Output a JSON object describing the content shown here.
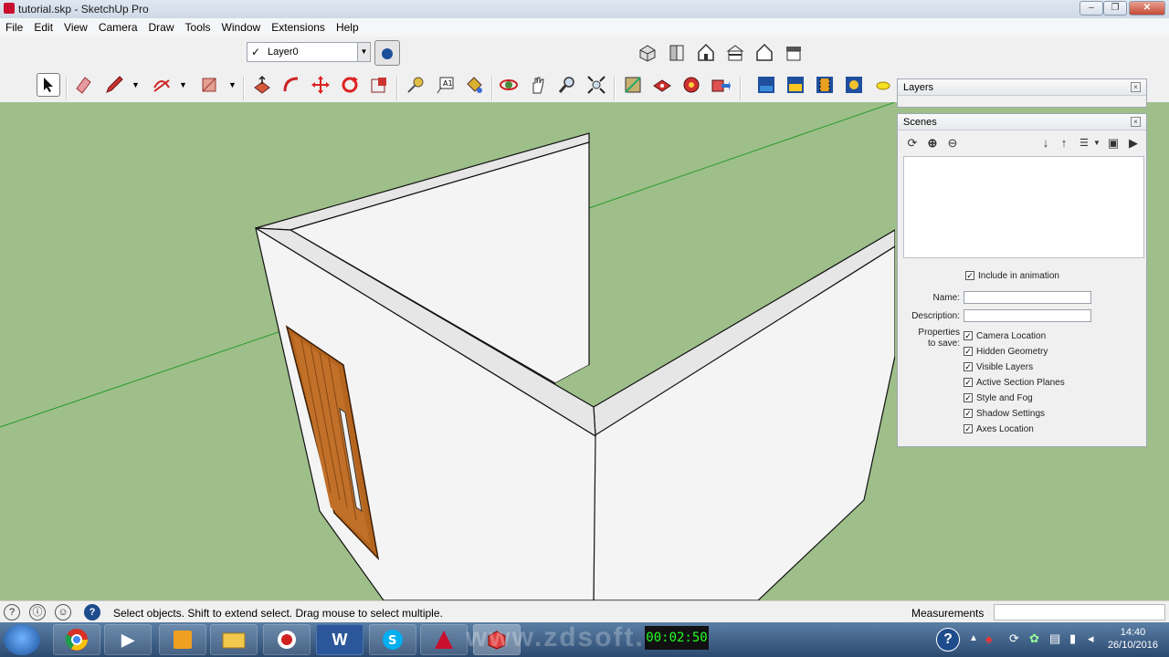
{
  "window": {
    "title": "tutorial.skp - SketchUp Pro",
    "controls": [
      "–",
      "❐",
      "✕"
    ]
  },
  "menu": [
    "File",
    "Edit",
    "View",
    "Camera",
    "Draw",
    "Tools",
    "Window",
    "Extensions",
    "Help"
  ],
  "layer_toolbar": {
    "current_layer": "Layer0",
    "check": "✓"
  },
  "tools": {
    "select": "select-arrow-icon",
    "eraser": "eraser-icon",
    "pencil": "pencil-icon",
    "arc": "arc-icon",
    "rectangle": "rectangle-icon",
    "push_pull": "push-pull-icon",
    "follow_me": "follow-me-icon",
    "move": "move-icon",
    "rotate": "rotate-icon",
    "scale": "scale-icon",
    "tape": "tape-measure-icon",
    "text": "text-icon",
    "paint": "paint-bucket-icon",
    "orbit": "orbit-icon",
    "pan": "pan-icon",
    "zoom": "zoom-icon",
    "zoom_extents": "zoom-extents-icon"
  },
  "layers_panel": {
    "title": "Layers",
    "close": "×"
  },
  "scenes_panel": {
    "title": "Scenes",
    "close": "×",
    "include_in_animation": "Include in animation",
    "name_label": "Name:",
    "description_label": "Description:",
    "properties_label": "Properties to save:",
    "name_value": "",
    "description_value": "",
    "properties": [
      "Camera Location",
      "Hidden Geometry",
      "Visible Layers",
      "Active Section Planes",
      "Style and Fog",
      "Shadow Settings",
      "Axes Location"
    ],
    "checked": "✓"
  },
  "status": {
    "message": "Select objects. Shift to extend select. Drag mouse to select multiple.",
    "measurements_label": "Measurements",
    "measurements_value": ""
  },
  "taskbar": {
    "time": "14:40",
    "date": "26/10/2016",
    "watermark": "www.zdsoft.com",
    "timer": "00:02:50"
  },
  "colors": {
    "ground": "#9ebf8a",
    "wall": "#f0f0f0",
    "door": "#b5651d",
    "axis_green": "#2a9a2a"
  }
}
